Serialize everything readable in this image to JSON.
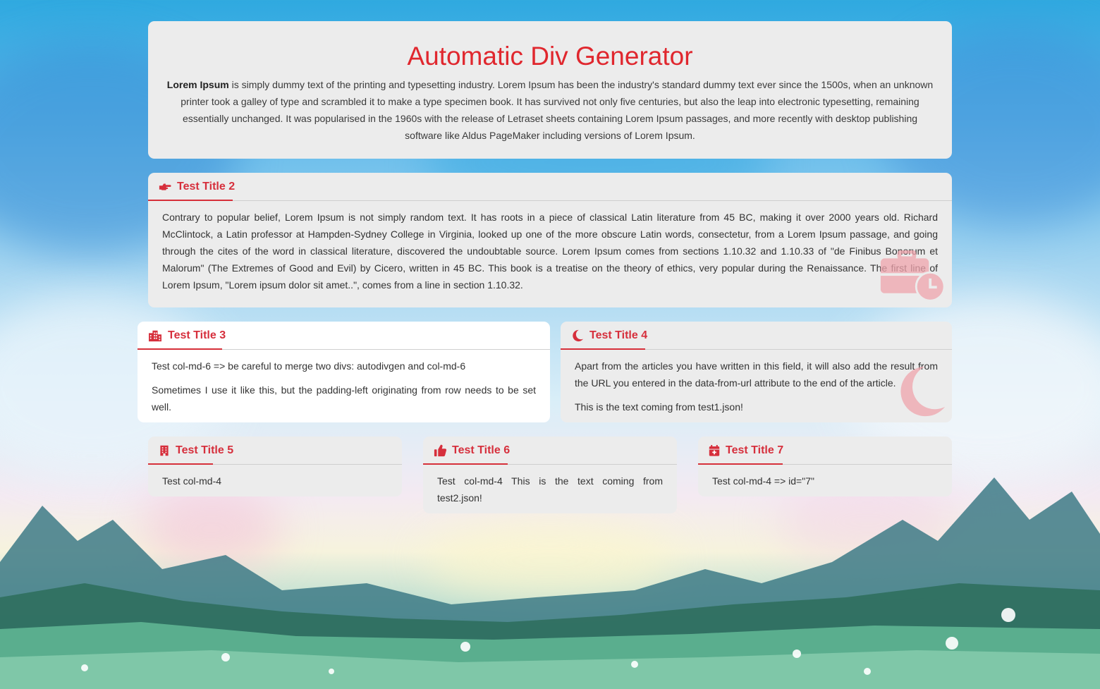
{
  "hero": {
    "title": "Automatic Div Generator",
    "lead_bold": "Lorem Ipsum",
    "lead_text": " is simply dummy text of the printing and typesetting industry. Lorem Ipsum has been the industry's standard dummy text ever since the 1500s, when an unknown printer took a galley of type and scrambled it to make a type specimen book. It has survived not only five centuries, but also the leap into electronic typesetting, remaining essentially unchanged. It was popularised in the 1960s with the release of Letraset sheets containing Lorem Ipsum passages, and more recently with desktop publishing software like Aldus PageMaker including versions of Lorem Ipsum."
  },
  "cards": [
    {
      "title": "Test Title 2",
      "icon": "hand-pointing-right-icon",
      "paragraphs": [
        "Contrary to popular belief, Lorem Ipsum is not simply random text. It has roots in a piece of classical Latin literature from 45 BC, making it over 2000 years old. Richard McClintock, a Latin professor at Hampden-Sydney College in Virginia, looked up one of the more obscure Latin words, consectetur, from a Lorem Ipsum passage, and going through the cites of the word in classical literature, discovered the undoubtable source. Lorem Ipsum comes from sections 1.10.32 and 1.10.33 of \"de Finibus Bonorum et Malorum\" (The Extremes of Good and Evil) by Cicero, written in 45 BC. This book is a treatise on the theory of ethics, very popular during the Renaissance. The first line of Lorem Ipsum, \"Lorem ipsum dolor sit amet..\", comes from a line in section 1.10.32."
      ],
      "watermark": "business-time-icon"
    },
    {
      "title": "Test Title 3",
      "icon": "city-icon",
      "paragraphs": [
        "Test col-md-6 => be careful to merge two divs: autodivgen and col-md-6",
        "Sometimes I use it like this, but the padding-left originating from row needs to be set well."
      ]
    },
    {
      "title": "Test Title 4",
      "icon": "moon-icon",
      "paragraphs": [
        "Apart from the articles you have written in this field, it will also add the result from the URL you entered in the data-from-url attribute to the end of the article.",
        "This is the text coming from test1.json!"
      ],
      "watermark": "moon-icon"
    },
    {
      "title": "Test Title 5",
      "icon": "building-icon",
      "paragraphs": [
        "Test col-md-4"
      ]
    },
    {
      "title": "Test Title 6",
      "icon": "thumbs-up-icon",
      "paragraphs": [
        "Test col-md-4 This is the text coming from test2.json!"
      ]
    },
    {
      "title": "Test Title 7",
      "icon": "calendar-plus-icon",
      "paragraphs": [
        "Test col-md-4 => id=\"7\""
      ]
    }
  ],
  "colors": {
    "accent": "#d62f3c",
    "title": "#e0272e",
    "card": "#ececec"
  }
}
